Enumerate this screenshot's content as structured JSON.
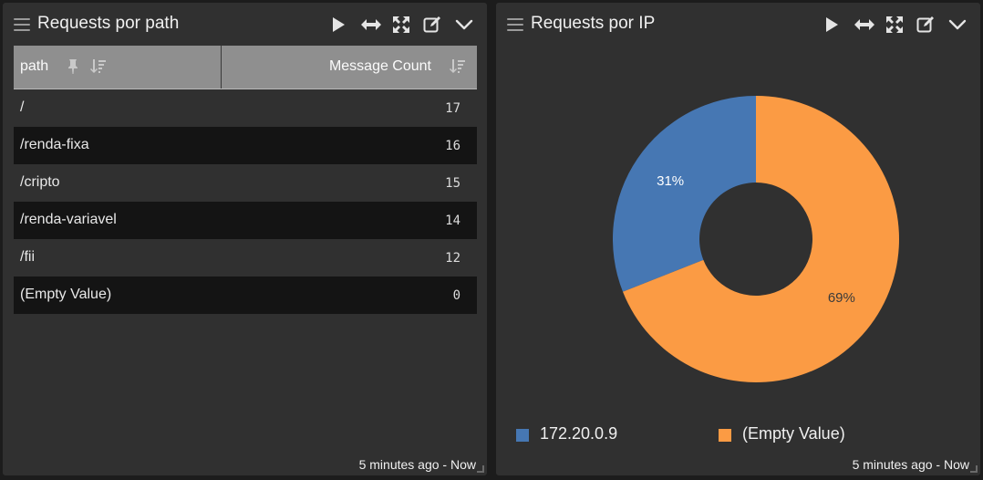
{
  "left_panel": {
    "title": "Requests por path",
    "table": {
      "columns": [
        "path",
        "Message Count"
      ],
      "rows": [
        {
          "path": "/",
          "count": "17"
        },
        {
          "path": "/renda-fixa",
          "count": "16"
        },
        {
          "path": "/cripto",
          "count": "15"
        },
        {
          "path": "/renda-variavel",
          "count": "14"
        },
        {
          "path": "/fii",
          "count": "12"
        },
        {
          "path": "(Empty Value)",
          "count": "0"
        }
      ]
    },
    "time_range": "5 minutes ago - Now",
    "header_icons": [
      "play-icon",
      "expand-horizontal-icon",
      "fullscreen-icon",
      "edit-icon",
      "chevron-down-icon"
    ]
  },
  "right_panel": {
    "title": "Requests por IP",
    "time_range": "5 minutes ago - Now",
    "header_icons": [
      "play-icon",
      "expand-horizontal-icon",
      "fullscreen-icon",
      "edit-icon",
      "chevron-down-icon"
    ],
    "legend": [
      {
        "label": "172.20.0.9",
        "color": "#4677b3"
      },
      {
        "label": "(Empty Value)",
        "color": "#fb9b44"
      }
    ]
  },
  "chart_data": {
    "type": "pie",
    "donut": true,
    "title": "Requests por IP",
    "series": [
      {
        "name": "172.20.0.9",
        "value": 31,
        "label": "31%",
        "color": "#4677b3"
      },
      {
        "name": "(Empty Value)",
        "value": 69,
        "label": "69%",
        "color": "#fb9b44"
      }
    ],
    "legend_position": "bottom"
  },
  "colors": {
    "panel_bg": "#303030",
    "page_bg": "#1c1c1c",
    "table_header_bg": "#8f8f8f",
    "row_even_bg": "#141414"
  }
}
